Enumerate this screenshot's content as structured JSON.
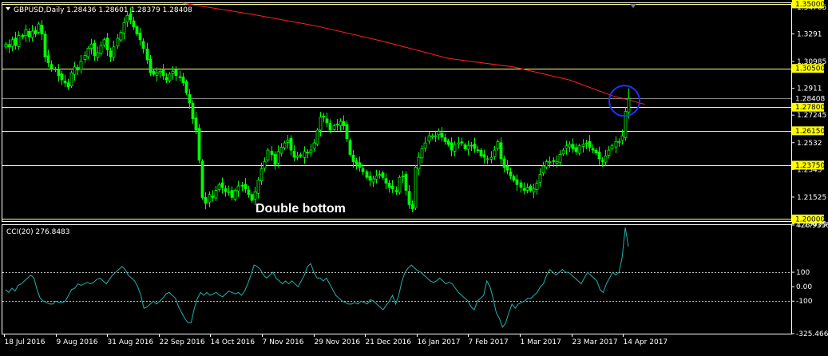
{
  "window": {
    "symbol_info": "GBPUSD,Daily  1.28436 1.28601 1.28379 1.28408",
    "chart_annotation": "Double bottom"
  },
  "colors": {
    "background": "#000000",
    "candle": "#00ff00",
    "moving_average": "#ff2020",
    "level_line": "#ffff80",
    "cci_line": "#20b2aa",
    "cci_level": "#c0c0c0",
    "circle": "#2030ff",
    "highlight_label": "#ffff00"
  },
  "chart_data": [
    {
      "type": "candlestick",
      "title": "GBPUSD,Daily  1.28436 1.28601 1.28379 1.28408",
      "x_tick_labels": [
        "18 Jul 2016",
        "9 Aug 2016",
        "31 Aug 2016",
        "22 Sep 2016",
        "14 Oct 2016",
        "7 Nov 2016",
        "29 Nov 2016",
        "21 Dec 2016",
        "16 Jan 2017",
        "7 Feb 2017",
        "1 Mar 2017",
        "23 Mar 2017",
        "14 Apr 2017"
      ],
      "ylim": [
        1.1985,
        1.3505
      ],
      "y_tick_labels": [
        {
          "value": 1.34765,
          "label": "1.34765"
        },
        {
          "value": 1.3291,
          "label": "1.3291"
        },
        {
          "value": 1.30985,
          "label": "1.30985"
        },
        {
          "value": 1.2911,
          "label": "1.2911"
        },
        {
          "value": 1.27245,
          "label": "1.27245"
        },
        {
          "value": 1.2532,
          "label": "1.2532"
        },
        {
          "value": 1.2345,
          "label": "1.2345"
        },
        {
          "value": 1.21525,
          "label": "1.21525"
        },
        {
          "value": 1.19655,
          "label": "1.19655"
        }
      ],
      "horizontal_levels": [
        {
          "value": 1.35,
          "label": "1.35000"
        },
        {
          "value": 1.305,
          "label": "1.30500"
        },
        {
          "value": 1.278,
          "label": "1.27800"
        },
        {
          "value": 1.2615,
          "label": "1.26150"
        },
        {
          "value": 1.2375,
          "label": "1.23750"
        },
        {
          "value": 1.2,
          "label": "1.20000"
        }
      ],
      "current_price": {
        "value": 1.28408,
        "label": "1.28408"
      },
      "closes": [
        1.322,
        1.32,
        1.325,
        1.321,
        1.328,
        1.327,
        1.332,
        1.327,
        1.331,
        1.329,
        1.336,
        1.329,
        1.313,
        1.309,
        1.305,
        1.304,
        1.3,
        1.297,
        1.295,
        1.292,
        1.302,
        1.306,
        1.304,
        1.31,
        1.314,
        1.319,
        1.322,
        1.314,
        1.316,
        1.321,
        1.325,
        1.318,
        1.313,
        1.32,
        1.326,
        1.33,
        1.337,
        1.342,
        1.339,
        1.334,
        1.329,
        1.325,
        1.319,
        1.311,
        1.302,
        1.301,
        1.302,
        1.303,
        1.3,
        1.297,
        1.301,
        1.303,
        1.3,
        1.299,
        1.295,
        1.288,
        1.281,
        1.27,
        1.262,
        1.241,
        1.215,
        1.211,
        1.217,
        1.215,
        1.22,
        1.224,
        1.222,
        1.219,
        1.219,
        1.215,
        1.22,
        1.223,
        1.223,
        1.221,
        1.217,
        1.213,
        1.219,
        1.227,
        1.235,
        1.24,
        1.248,
        1.245,
        1.238,
        1.247,
        1.25,
        1.253,
        1.255,
        1.248,
        1.243,
        1.244,
        1.244,
        1.247,
        1.246,
        1.248,
        1.253,
        1.262,
        1.271,
        1.271,
        1.267,
        1.262,
        1.265,
        1.266,
        1.268,
        1.265,
        1.256,
        1.245,
        1.24,
        1.238,
        1.236,
        1.233,
        1.229,
        1.227,
        1.228,
        1.23,
        1.231,
        1.229,
        1.225,
        1.222,
        1.221,
        1.219,
        1.229,
        1.23,
        1.22,
        1.21,
        1.207,
        1.236,
        1.243,
        1.249,
        1.253,
        1.258,
        1.258,
        1.258,
        1.261,
        1.257,
        1.254,
        1.252,
        1.248,
        1.252,
        1.253,
        1.253,
        1.249,
        1.251,
        1.251,
        1.249,
        1.248,
        1.244,
        1.243,
        1.242,
        1.243,
        1.248,
        1.254,
        1.242,
        1.236,
        1.234,
        1.23,
        1.227,
        1.224,
        1.222,
        1.22,
        1.222,
        1.22,
        1.221,
        1.225,
        1.231,
        1.237,
        1.24,
        1.24,
        1.24,
        1.24,
        1.245,
        1.248,
        1.251,
        1.252,
        1.249,
        1.247,
        1.251,
        1.252,
        1.253,
        1.25,
        1.248,
        1.246,
        1.242,
        1.24,
        1.244,
        1.248,
        1.251,
        1.254,
        1.254,
        1.258,
        1.275,
        1.284
      ],
      "moving_average": [
        {
          "x_index": 54,
          "value": 1.3505
        },
        {
          "x_index": 75,
          "value": 1.3428
        },
        {
          "x_index": 95,
          "value": 1.3345
        },
        {
          "x_index": 115,
          "value": 1.324
        },
        {
          "x_index": 135,
          "value": 1.312
        },
        {
          "x_index": 155,
          "value": 1.306
        },
        {
          "x_index": 172,
          "value": 1.297
        },
        {
          "x_index": 185,
          "value": 1.286
        },
        {
          "x_index": 195,
          "value": 1.28
        }
      ]
    },
    {
      "type": "line",
      "title": "CCI(20) 276.8483",
      "ylim": [
        -325.4667,
        426.9356
      ],
      "y_tick_labels": [
        {
          "value": 426.9356,
          "label": "426.9356"
        },
        {
          "value": 100,
          "label": "100"
        },
        {
          "value": 0,
          "label": "0.00"
        },
        {
          "value": -100,
          "label": "-100"
        },
        {
          "value": -325.4667,
          "label": "-325.4667"
        }
      ],
      "levels": [
        100,
        -100
      ],
      "values": [
        -20,
        -40,
        -10,
        -30,
        10,
        20,
        40,
        60,
        80,
        60,
        -20,
        -80,
        -100,
        -110,
        -120,
        -120,
        -100,
        -110,
        -110,
        -100,
        -60,
        -20,
        -10,
        20,
        10,
        20,
        30,
        20,
        30,
        50,
        60,
        40,
        20,
        50,
        80,
        100,
        120,
        140,
        120,
        80,
        60,
        40,
        0,
        -60,
        -150,
        -140,
        -120,
        -100,
        -120,
        -100,
        -80,
        -50,
        -40,
        -60,
        -80,
        -140,
        -180,
        -220,
        -250,
        -250,
        -150,
        -80,
        -40,
        -60,
        -40,
        -60,
        -50,
        -40,
        -60,
        -70,
        -50,
        -30,
        -40,
        -50,
        -40,
        -60,
        -30,
        20,
        80,
        150,
        140,
        120,
        80,
        60,
        80,
        100,
        60,
        40,
        20,
        40,
        20,
        40,
        20,
        0,
        40,
        80,
        140,
        160,
        100,
        60,
        60,
        40,
        60,
        20,
        -20,
        -60,
        -80,
        -100,
        -110,
        -120,
        -120,
        -110,
        -120,
        -100,
        -110,
        -120,
        -90,
        -100,
        -120,
        -140,
        -160,
        -130,
        -100,
        -60,
        -120,
        -60,
        40,
        100,
        130,
        150,
        130,
        110,
        100,
        80,
        60,
        40,
        30,
        40,
        60,
        40,
        20,
        30,
        20,
        -10,
        -40,
        -60,
        -80,
        -100,
        -140,
        -160,
        -100,
        -80,
        -60,
        40,
        0,
        -80,
        -180,
        -220,
        -280,
        -250,
        -180,
        -120,
        -150,
        -120,
        -110,
        -100,
        -80,
        -80,
        -60,
        -40,
        0,
        20,
        80,
        120,
        100,
        80,
        100,
        120,
        100,
        100,
        80,
        60,
        40,
        20,
        60,
        100,
        80,
        60,
        40,
        -20,
        -40,
        20,
        60,
        100,
        80,
        100,
        200,
        410,
        277
      ]
    }
  ]
}
